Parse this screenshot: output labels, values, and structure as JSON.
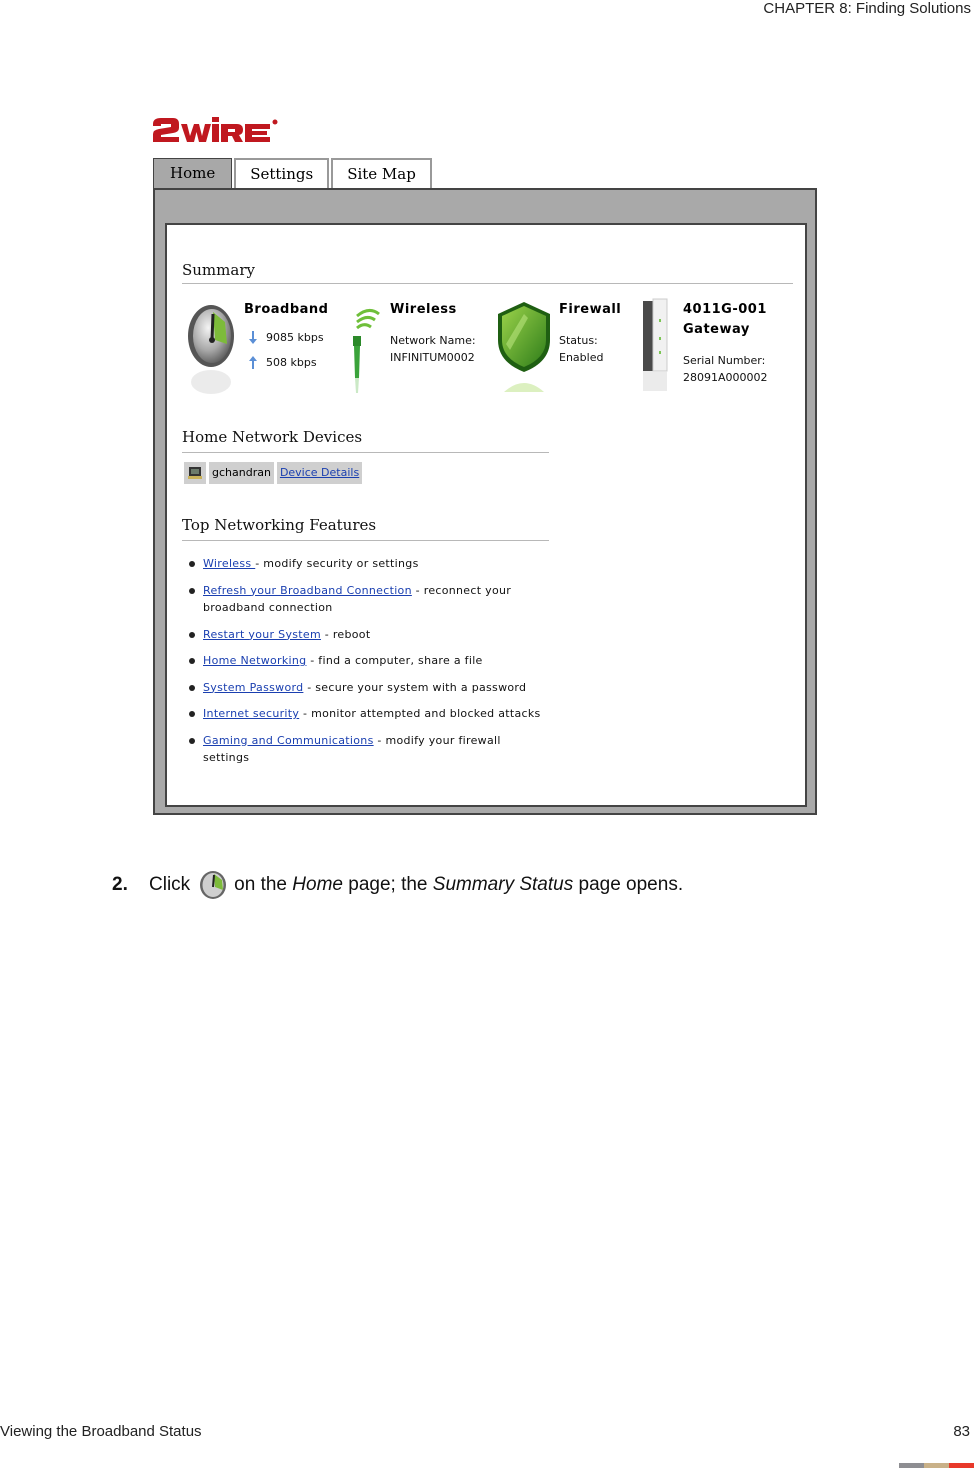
{
  "document": {
    "running_head": "CHAPTER 8: Finding Solutions",
    "footer_title": "Viewing the Broadband Status",
    "page_number": "83",
    "footer_bar_colors": [
      "#8e8e92",
      "#c9b188",
      "#e8392a"
    ]
  },
  "screenshot": {
    "brand": {
      "name": "2WIRE",
      "color": "#c0181f"
    },
    "tabs": [
      {
        "label": "Home",
        "active": true
      },
      {
        "label": "Settings",
        "active": false
      },
      {
        "label": "Site Map",
        "active": false
      }
    ],
    "summary": {
      "title": "Summary",
      "broadband": {
        "title": "Broadband",
        "icon": "speedometer-icon",
        "download": "9085 kbps",
        "upload": "508 kbps"
      },
      "wireless": {
        "title": "Wireless",
        "icon": "antenna-icon",
        "network_label": "Network Name:",
        "network_name": "INFINITUM0002"
      },
      "firewall": {
        "title": "Firewall",
        "icon": "shield-icon",
        "status_label": "Status:",
        "status_value": "Enabled"
      },
      "gateway": {
        "model": "4011G-001",
        "title": "Gateway",
        "icon": "gateway-device-icon",
        "serial_label": "Serial Number:",
        "serial_value": "28091A000002"
      }
    },
    "home_network": {
      "title": "Home Network Devices",
      "devices": [
        {
          "icon": "computer-icon",
          "name": "gchandran",
          "link": "Device Details"
        }
      ]
    },
    "features": {
      "title": "Top Networking Features",
      "items": [
        {
          "link": "Wireless ",
          "desc": " - modify security or settings"
        },
        {
          "link": "Refresh your Broadband Connection",
          "desc": " - reconnect your broadband connection"
        },
        {
          "link": "Restart your System",
          "desc": " - reboot"
        },
        {
          "link": "Home Networking",
          "desc": " - find a computer, share a file"
        },
        {
          "link": "System Password",
          "desc": " - secure your system with a password"
        },
        {
          "link": "Internet security",
          "desc": " - monitor attempted and blocked attacks"
        },
        {
          "link": "Gaming and Communications",
          "desc": " - modify your firewall settings"
        }
      ]
    }
  },
  "step": {
    "number": "2.",
    "before_icon": "Click",
    "icon": "speedometer-icon",
    "after_icon": "on the",
    "page1": "Home",
    "middle": "page; the",
    "page2": "Summary Status",
    "end": "page opens."
  }
}
